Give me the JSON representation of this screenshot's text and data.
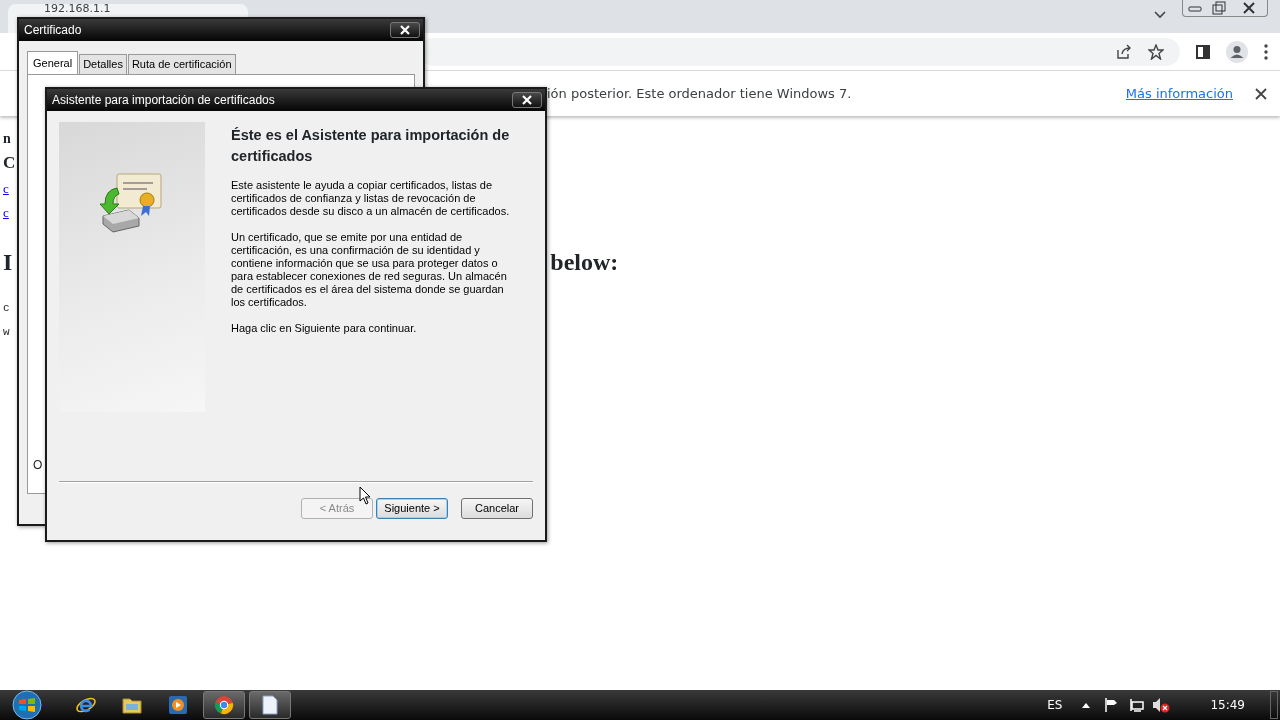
{
  "browser": {
    "tab_title": "192.168.1.1",
    "infobar": {
      "message": "ión posterior. Este ordenador tiene Windows 7.",
      "link": "Más información"
    },
    "page_fragments": [
      {
        "text": "n",
        "kind": "bold"
      },
      {
        "text": "C",
        "kind": "heading"
      },
      {
        "text": "c",
        "kind": "link"
      },
      {
        "text": "c",
        "kind": "link"
      },
      {
        "text": "I",
        "kind": "bigheading"
      },
      {
        "text": "below:",
        "kind": "bigheading-right"
      },
      {
        "text": "c",
        "kind": "small"
      },
      {
        "text": "w",
        "kind": "small"
      }
    ]
  },
  "certificate_dialog": {
    "title": "Certificado",
    "tabs": [
      {
        "label": "General",
        "selected": true
      },
      {
        "label": "Detalles",
        "selected": false
      },
      {
        "label": "Ruta de certificación",
        "selected": false
      }
    ],
    "fragment": "O"
  },
  "wizard": {
    "title": "Asistente para importación de certificados",
    "heading": "Éste es el Asistente para importación de certificados",
    "paragraphs": [
      "Este asistente le ayuda a copiar certificados, listas de certificados de confianza y listas de revocación de certificados desde su disco a un almacén de certificados.",
      "Un certificado, que se emite por una entidad de certificación, es una confirmación de su identidad y contiene información que se usa para proteger datos o para establecer conexiones de red seguras. Un almacén de certificados es el área del sistema donde se guardan los certificados.",
      "Haga clic en Siguiente para continuar."
    ],
    "buttons": [
      {
        "label": "< Atrás",
        "disabled": true,
        "default": false
      },
      {
        "label": "Siguiente >",
        "disabled": false,
        "default": true
      },
      {
        "label": "Cancelar",
        "disabled": false,
        "default": false
      }
    ]
  },
  "taskbar": {
    "items": [
      {
        "kind": "ie",
        "active": false
      },
      {
        "kind": "folder",
        "active": false
      },
      {
        "kind": "media",
        "active": false
      },
      {
        "kind": "chrome",
        "active": true
      },
      {
        "kind": "document",
        "active": true
      }
    ],
    "language": "ES",
    "clock": "15:49"
  }
}
